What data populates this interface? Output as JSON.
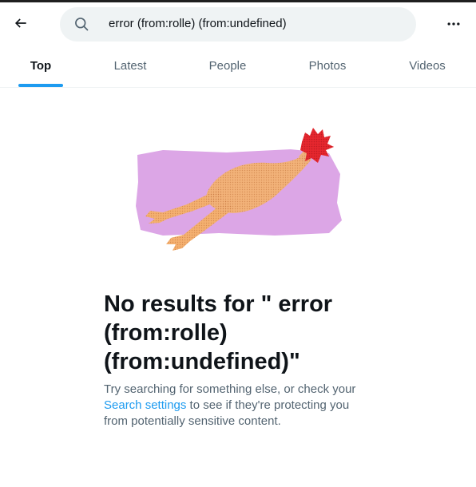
{
  "header": {
    "search_query": "error (from:rolle) (from:undefined)",
    "back_icon": "arrow-left-icon",
    "search_icon": "search-icon",
    "more_icon": "more-horizontal-icon"
  },
  "tabs": [
    {
      "label": "Top",
      "active": true
    },
    {
      "label": "Latest",
      "active": false
    },
    {
      "label": "People",
      "active": false
    },
    {
      "label": "Photos",
      "active": false
    },
    {
      "label": "Videos",
      "active": false
    }
  ],
  "empty_state": {
    "illustration": "rubber-chicken-illustration",
    "title": "No results for \" error (from:rolle) (from:undefined)\"",
    "desc_before": "Try searching for something else, or check your ",
    "settings_link": "Search settings",
    "desc_after": " to see if they're protecting you from potentially sensitive content."
  },
  "colors": {
    "accent": "#1d9bf0",
    "secondary_text": "#536471",
    "illustration_bg": "#dca6e6"
  }
}
